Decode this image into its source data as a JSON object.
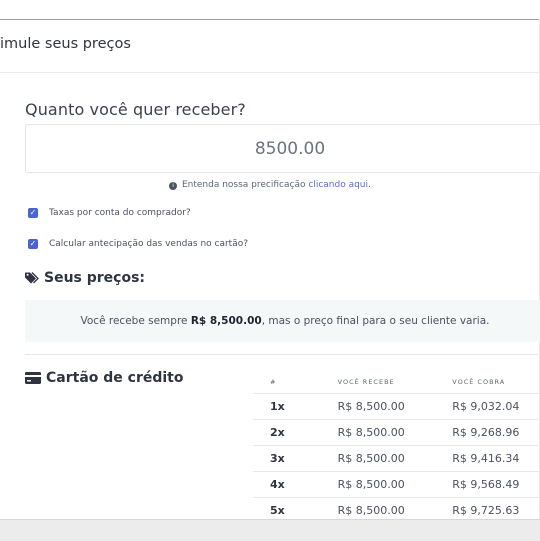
{
  "page_title": "imule seus preços",
  "question": "Quanto você quer receber?",
  "amount_value": "8500.00",
  "info": {
    "text": "Entenda nossa precificação",
    "link": "clicando aqui",
    "suffix": "."
  },
  "checkboxes": [
    {
      "label": "Taxas por conta do comprador?",
      "checked": true
    },
    {
      "label": "Calcular antecipação das vendas no cartão?",
      "checked": true
    }
  ],
  "prices_section": {
    "title": "Seus preços:",
    "box_prefix": "Você recebe sempre ",
    "box_amount": "R$ 8,500.00",
    "box_suffix": ", mas o preço final para o seu cliente varia."
  },
  "card_section": {
    "title": "Cartão de crédito",
    "columns": [
      "#",
      "VOCÊ RECEBE",
      "VOCÊ COBRA"
    ],
    "rows": [
      {
        "n": "1x",
        "recebe": "R$ 8,500.00",
        "cobra": "R$ 9,032.04"
      },
      {
        "n": "2x",
        "recebe": "R$ 8,500.00",
        "cobra": "R$ 9,268.96"
      },
      {
        "n": "3x",
        "recebe": "R$ 8,500.00",
        "cobra": "R$ 9,416.34"
      },
      {
        "n": "4x",
        "recebe": "R$ 8,500.00",
        "cobra": "R$ 9,568.49"
      },
      {
        "n": "5x",
        "recebe": "R$ 8,500.00",
        "cobra": "R$ 9,725.63"
      }
    ]
  },
  "colors": {
    "accent": "#4c63d2",
    "link": "#5b6dd6",
    "box_bg": "#f4f8f8"
  },
  "icons": {
    "info": "info-circle-icon",
    "tags": "tags-icon",
    "card": "credit-card-icon",
    "check": "check-icon"
  }
}
